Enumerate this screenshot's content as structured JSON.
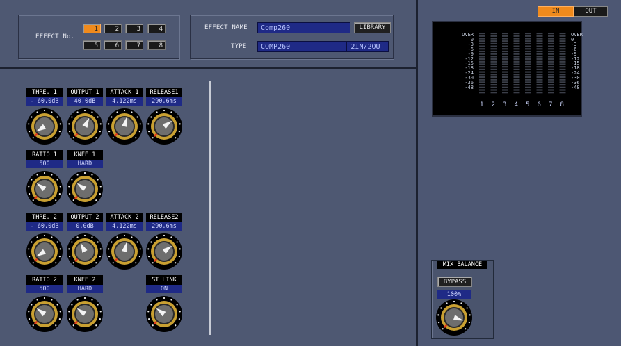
{
  "effect": {
    "number_label": "EFFECT No.",
    "numbers": [
      "1",
      "2",
      "3",
      "4",
      "5",
      "6",
      "7",
      "8"
    ],
    "active_number": "1",
    "name_label": "EFFECT NAME",
    "name_value": "Comp260",
    "library_label": "LIBRARY",
    "type_label": "TYPE",
    "type_value": "COMP260",
    "io_value": "2IN/2OUT"
  },
  "io_toggle": {
    "in_label": "IN",
    "out_label": "OUT",
    "active": "IN"
  },
  "meter": {
    "scale_left": [
      "OVER",
      "0",
      "-3",
      "-6",
      "-9",
      "-12",
      "-15",
      "-18",
      "-24",
      "-30",
      "-36",
      "-48"
    ],
    "scale_right": [
      "OVER",
      "0",
      "-3",
      "-6",
      "-9",
      "-12",
      "-15",
      "-18",
      "-24",
      "-30",
      "-36",
      "-48"
    ],
    "channels": [
      "1",
      "2",
      "3",
      "4",
      "5",
      "6",
      "7",
      "8"
    ]
  },
  "knobs": [
    {
      "id": "thre1",
      "title": "THRE. 1",
      "value": "- 60.0dB",
      "level": 0.05
    },
    {
      "id": "output1",
      "title": "OUTPUT 1",
      "value": "40.0dB",
      "level": 0.6
    },
    {
      "id": "attack1",
      "title": "ATTACK 1",
      "value": "4.122ms",
      "level": 0.55
    },
    {
      "id": "release1",
      "title": "RELEASE1",
      "value": "290.6ms",
      "level": 0.7
    },
    {
      "id": "ratio1",
      "title": "RATIO 1",
      "value": "500",
      "level": 0.3
    },
    {
      "id": "knee1",
      "title": "KNEE 1",
      "value": "HARD",
      "level": 0.3
    },
    {
      "id": "thre2",
      "title": "THRE. 2",
      "value": "- 60.0dB",
      "level": 0.05
    },
    {
      "id": "output2",
      "title": "OUTPUT 2",
      "value": "0.0dB",
      "level": 0.4
    },
    {
      "id": "attack2",
      "title": "ATTACK 2",
      "value": "4.122ms",
      "level": 0.55
    },
    {
      "id": "release2",
      "title": "RELEASE2",
      "value": "290.6ms",
      "level": 0.7
    },
    {
      "id": "ratio2",
      "title": "RATIO 2",
      "value": "500",
      "level": 0.3
    },
    {
      "id": "knee2",
      "title": "KNEE 2",
      "value": "HARD",
      "level": 0.3
    },
    {
      "id": "stlink",
      "title": "ST LINK",
      "value": "ON",
      "level": 0.3
    }
  ],
  "mix_balance": {
    "title": "MIX BALANCE",
    "bypass_label": "BYPASS",
    "value": "100%",
    "level": 0.9
  },
  "colors": {
    "accent_orange": "#f08a1c",
    "field_blue": "#1f2a86",
    "panel": "#4e5872"
  }
}
